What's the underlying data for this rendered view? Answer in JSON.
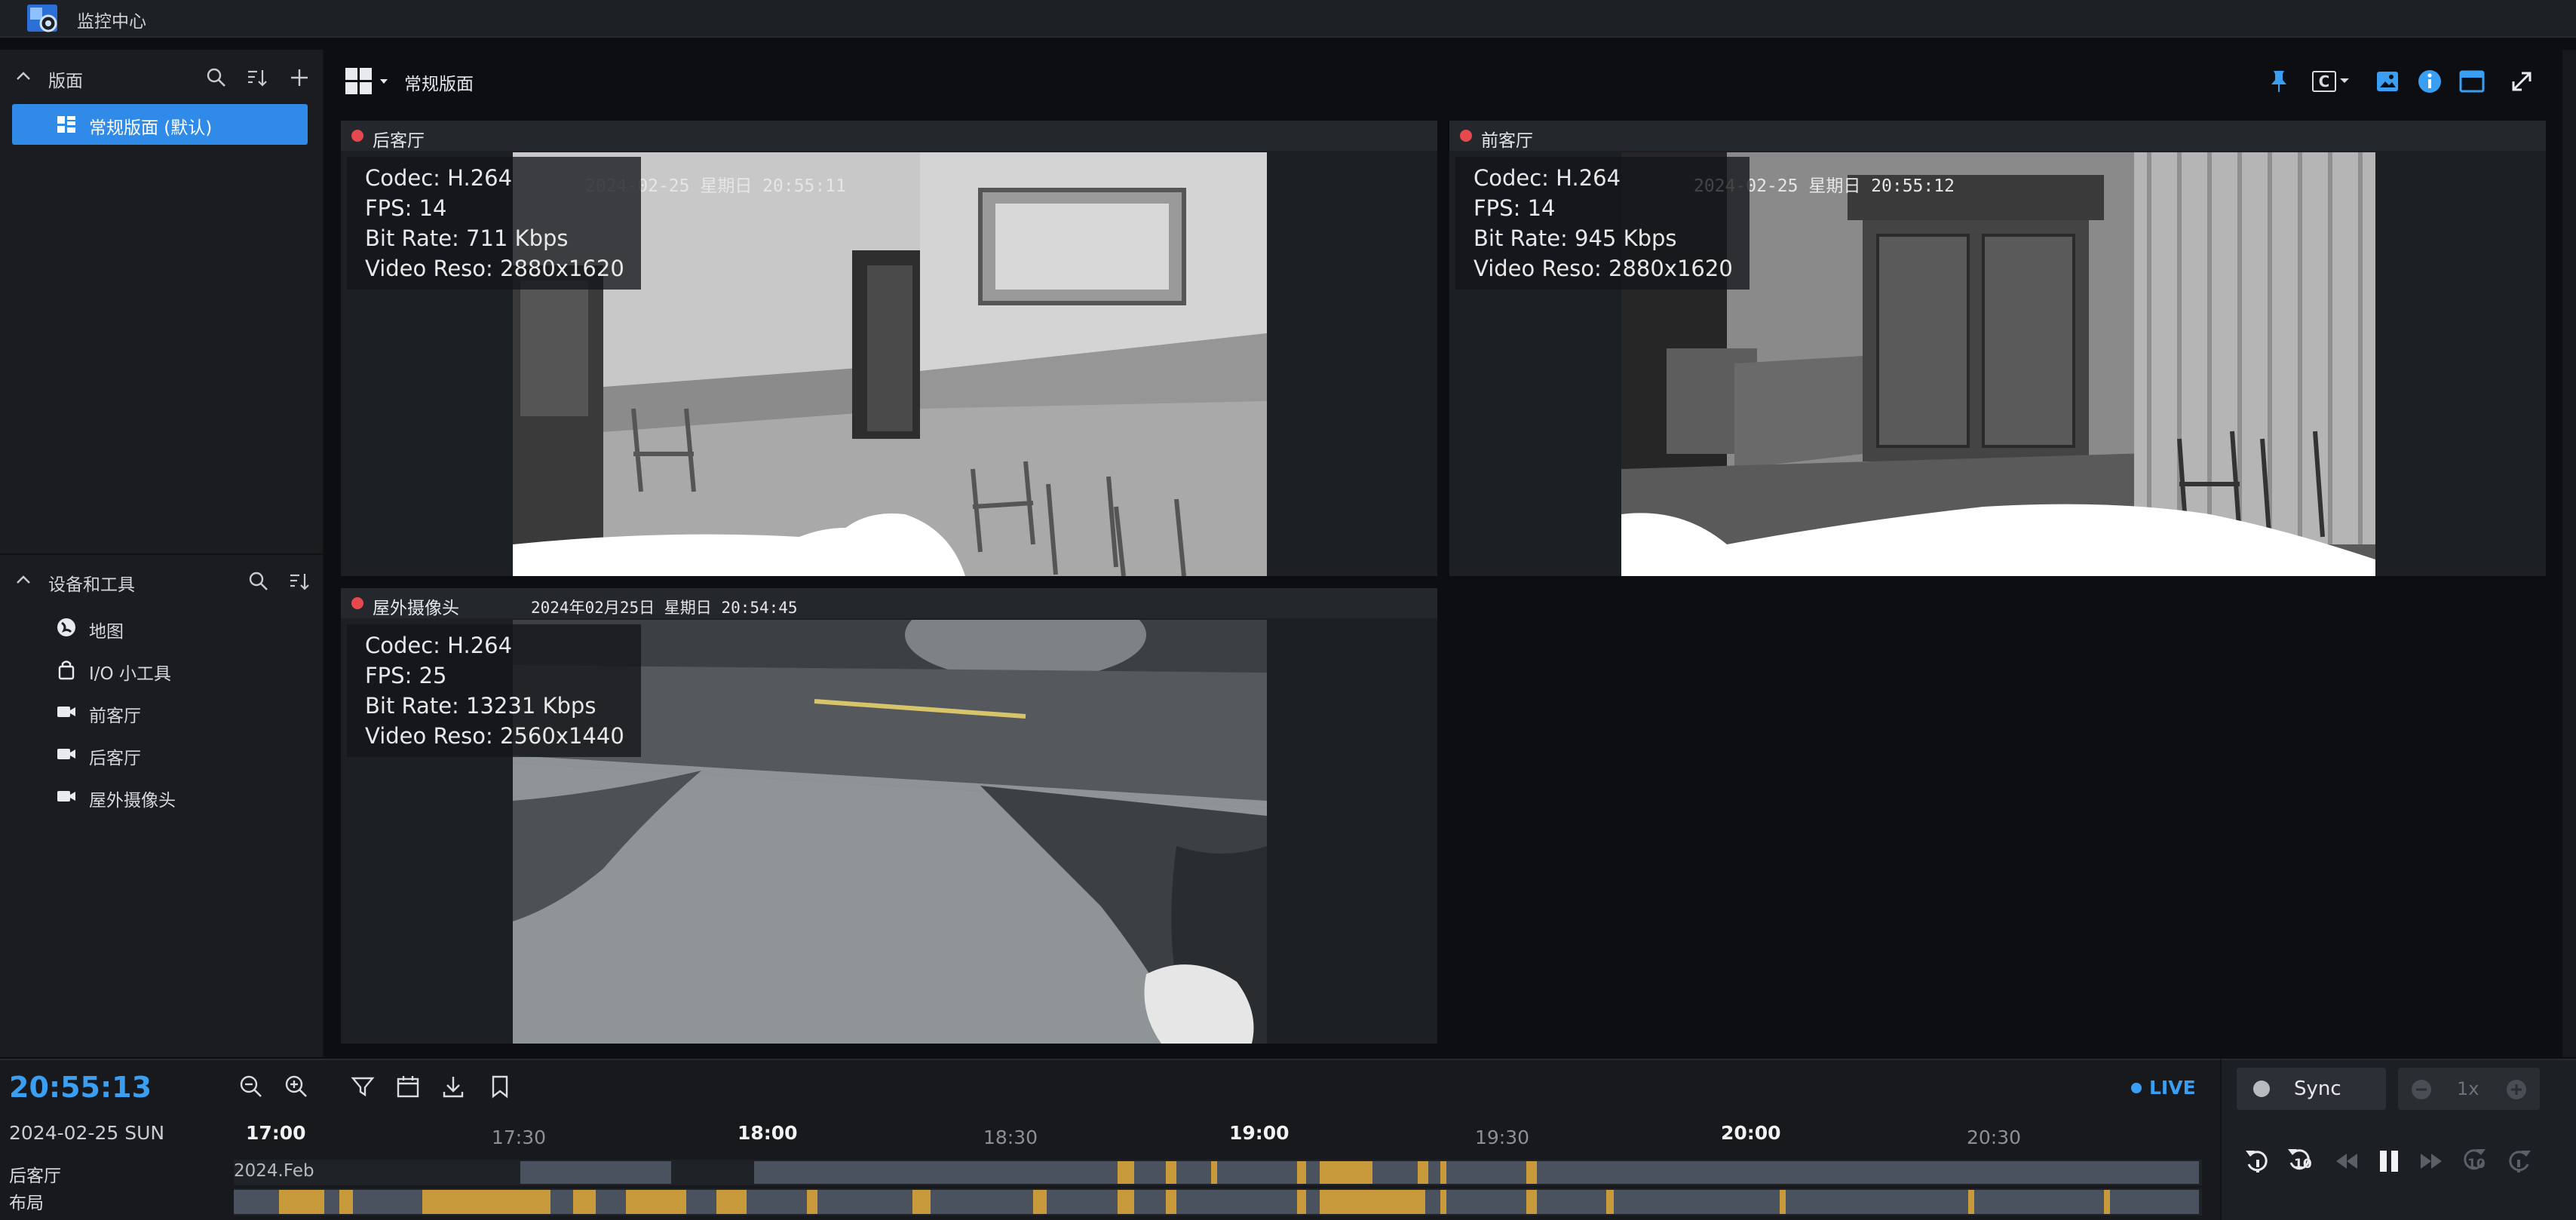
{
  "app": {
    "title": "监控中心"
  },
  "sidebar": {
    "layouts_section": {
      "label": "版面"
    },
    "layouts": [
      {
        "label": "常规版面 (默认)"
      }
    ],
    "devices_section": {
      "label": "设备和工具"
    },
    "devices": [
      {
        "label": "地图",
        "icon": "map-icon"
      },
      {
        "label": "I/O 小工具",
        "icon": "io-module-icon"
      },
      {
        "label": "前客厅",
        "icon": "camera-icon"
      },
      {
        "label": "后客厅",
        "icon": "camera-icon"
      },
      {
        "label": "屋外摄像头",
        "icon": "camera-icon"
      }
    ]
  },
  "main": {
    "layout_name": "常规版面",
    "aspect_option": "C",
    "cameras": [
      {
        "name": "后客厅",
        "osd": "2024-02-25  星期日  20:55:11",
        "codec": "Codec: H.264",
        "fps": "FPS: 14",
        "bitrate": "Bit Rate: 711 Kbps",
        "reso": "Video Reso: 2880x1620"
      },
      {
        "name": "前客厅",
        "osd": "2024-02-25  星期日  20:55:12",
        "codec": "Codec: H.264",
        "fps": "FPS: 14",
        "bitrate": "Bit Rate: 945 Kbps",
        "reso": "Video Reso: 2880x1620"
      },
      {
        "name": "屋外摄像头",
        "osd": "2024年02月25日  星期日  20:54:45",
        "codec": "Codec: H.264",
        "fps": "FPS: 25",
        "bitrate": "Bit Rate: 13231 Kbps",
        "reso": "Video Reso: 2560x1440"
      }
    ]
  },
  "timeline": {
    "clock": "20:55:13",
    "date": "2024-02-25 SUN",
    "live_label": "LIVE",
    "ticks": [
      "17:00",
      "17:30",
      "18:00",
      "18:30",
      "19:00",
      "19:30",
      "20:00",
      "20:30"
    ],
    "date_marker": "2024.Feb",
    "tracks": [
      {
        "label": "后客厅"
      },
      {
        "label": "布局"
      }
    ]
  },
  "controls": {
    "sync_label": "Sync",
    "speed": "1x",
    "skip_back_label": "10",
    "skip_fwd_label": "10"
  },
  "colors": {
    "accent": "#2f8be7",
    "recording": "#e5484d",
    "event": "#c89a3c",
    "continuous": "#4a5260"
  }
}
